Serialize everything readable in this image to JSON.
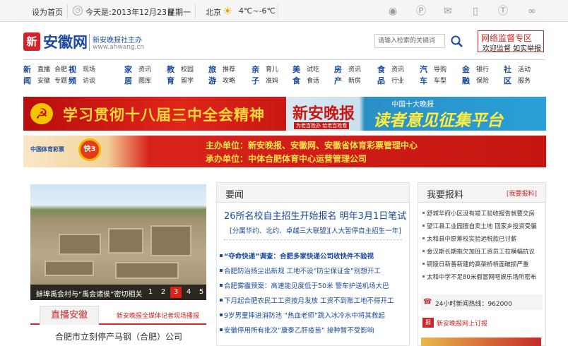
{
  "topbar": {
    "set_home": "设为首页",
    "date_prefix": "今天是:",
    "date": "2013年12月23日",
    "weekday": "星期一",
    "city": "北京",
    "temp": "4℃~-6℃",
    "icons": [
      "weibo-icon",
      "pinterest-icon",
      "wechat-icon",
      "mobile-icon",
      "tencent-weibo-icon",
      "brand-icon"
    ]
  },
  "header": {
    "logo_char": "新",
    "site_name": "安徽网",
    "tagline": "新安晚报社主办",
    "url": "www.ahwang.cn",
    "search_placeholder": "请输入检索的关键词",
    "supervise_title": "网络监督专区",
    "supervise_sub": "欢迎监督 如实举报"
  },
  "nav": [
    {
      "h": [
        "新",
        "闻"
      ],
      "subs": [
        [
          "直播",
          "安徽"
        ],
        [
          "合肥",
          "专题"
        ]
      ]
    },
    {
      "h": [
        "视",
        "频"
      ],
      "subs": [
        [
          "现场",
          "访谈"
        ]
      ]
    },
    {
      "h": [
        "家",
        "居"
      ],
      "subs": [
        [
          "资讯",
          "图库"
        ]
      ]
    },
    {
      "h": [
        "教",
        "育"
      ],
      "subs": [
        [
          "校园",
          "留学"
        ]
      ]
    },
    {
      "h": [
        "旅",
        "游"
      ],
      "subs": [
        [
          "推荐",
          "攻略"
        ]
      ]
    },
    {
      "h": [
        "亲",
        "子"
      ],
      "subs": [
        [
          "育儿",
          "准妈"
        ]
      ]
    },
    {
      "h": [
        "美",
        "食"
      ],
      "subs": [
        [
          "试吃",
          "食话"
        ]
      ]
    },
    {
      "h": [
        "房",
        "产"
      ],
      "subs": [
        [
          "资讯",
          "新房"
        ]
      ]
    },
    {
      "h": [
        "食",
        "品"
      ],
      "subs": [
        [
          "资讯",
          "行业"
        ]
      ]
    },
    {
      "h": [
        "汽",
        "车"
      ],
      "subs": [
        [
          "导购",
          "车型"
        ]
      ]
    },
    {
      "h": [
        "金",
        "融"
      ],
      "subs": [
        [
          "银行",
          "保险"
        ]
      ]
    },
    {
      "h": [
        "社",
        "区"
      ],
      "subs": [
        [
          "活动",
          "服务"
        ]
      ]
    }
  ],
  "banners": {
    "b1": "学习贯彻十八届三中全会精神",
    "b1_flag": "☭",
    "b2_paper": "新安晚报",
    "b2_slogan": "为老百姓办 给老百姓看",
    "b2_top": "中国十大晚报",
    "b2_big": "读者意见征集平台",
    "b3_logo": "中国体育彩票",
    "b3_ball": "快3",
    "b3_l1": "主办单位：新安晚报、安徽网、安徽省体育彩票管理中心",
    "b3_l2": "承办单位：中体合肥体育中心运营管理公司"
  },
  "photo": {
    "caption": "蚌埠禹会村与“禹会诸侯”密切相关",
    "pages": [
      "1",
      "2",
      "3",
      "4",
      "5"
    ],
    "active_page": 3
  },
  "live": {
    "tab": "直播安徽",
    "right": "新安晚报全媒体记者现场播报",
    "item": "合肥市立刻停产马钢（合肥）公司"
  },
  "news": {
    "title": "要闻",
    "headline": "26所名校自主招生开始报名 明年3月1日笔试",
    "subheadline": "[分属华约、北约、卓越三大联盟][人大暂停自主招生一年]",
    "items": [
      {
        "t": "“夺命快递”调查：合肥多家快递公司收快件不验视",
        "bold": true
      },
      {
        "t": "合肥防治扬尘出新规 工地不设“防尘保证金”别想开工",
        "bold": false
      },
      {
        "t": "合肥雾霾预案：高速能见度低于50米 警车护送机场大巴",
        "bold": false
      },
      {
        "t": "下月起合肥农民工工资按月发放 工资不到账工地不得开工",
        "bold": false
      },
      {
        "t": "9岁男童摔进消防池 “热血老师”跳入冰冷水中将其救起",
        "bold": false
      },
      {
        "t": "安徽停用所有批次“康泰乙肝疫苗” 接种暂不受影响",
        "bold": false
      }
    ]
  },
  "report": {
    "title": "我要报料",
    "link": "[我要报料]",
    "items": [
      "舒城华府小区没有竣工验收报告就要交房",
      "望江县工业园擅自卖土地 回家乡投资受骗",
      "太和县中原筹校实验远税款已讨薪",
      "金汉斯长期拖欠加班工资员工拉横幅抗议",
      "铜陵日新善新建的高架桥桥面破损严重",
      "太和中学不足80米假冒网吧娱乐场所密布"
    ],
    "hotline": "24小时新闻热线：962000",
    "subscribe": "新安晚报网上订报"
  }
}
